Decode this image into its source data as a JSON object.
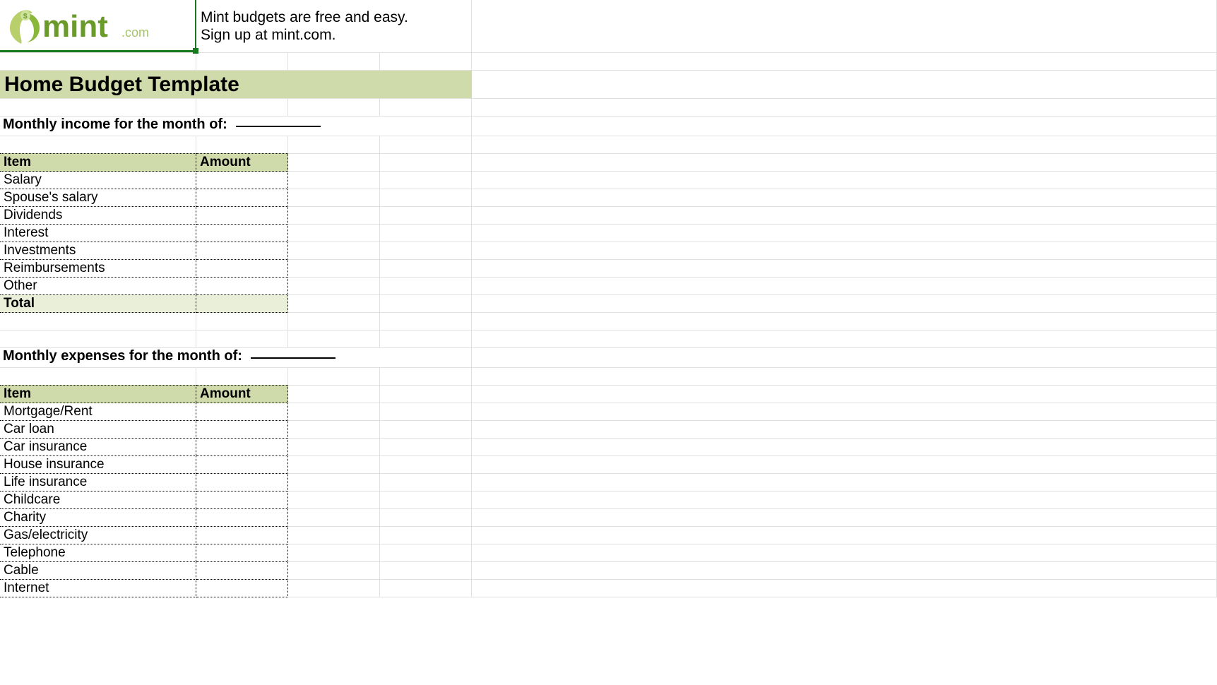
{
  "brand": {
    "name": "mint",
    "suffix": ".com"
  },
  "tagline": {
    "line1": "Mint budgets are free and easy.",
    "line2": "Sign up at mint.com."
  },
  "title": "Home Budget Template",
  "income_section": {
    "label": "Monthly income for the month of:",
    "headers": {
      "item": "Item",
      "amount": "Amount"
    },
    "rows": [
      {
        "item": "Salary",
        "amount": ""
      },
      {
        "item": "Spouse's salary",
        "amount": ""
      },
      {
        "item": "Dividends",
        "amount": ""
      },
      {
        "item": "Interest",
        "amount": ""
      },
      {
        "item": "Investments",
        "amount": ""
      },
      {
        "item": "Reimbursements",
        "amount": ""
      },
      {
        "item": "Other",
        "amount": ""
      }
    ],
    "total_label": "Total",
    "total_amount": ""
  },
  "expenses_section": {
    "label": "Monthly expenses for the month of:",
    "headers": {
      "item": "Item",
      "amount": "Amount"
    },
    "rows": [
      {
        "item": "Mortgage/Rent",
        "amount": ""
      },
      {
        "item": "Car loan",
        "amount": ""
      },
      {
        "item": "Car insurance",
        "amount": ""
      },
      {
        "item": "House insurance",
        "amount": ""
      },
      {
        "item": "Life insurance",
        "amount": ""
      },
      {
        "item": "Childcare",
        "amount": ""
      },
      {
        "item": "Charity",
        "amount": ""
      },
      {
        "item": "Gas/electricity",
        "amount": ""
      },
      {
        "item": "Telephone",
        "amount": ""
      },
      {
        "item": "Cable",
        "amount": ""
      },
      {
        "item": "Internet",
        "amount": ""
      }
    ]
  }
}
